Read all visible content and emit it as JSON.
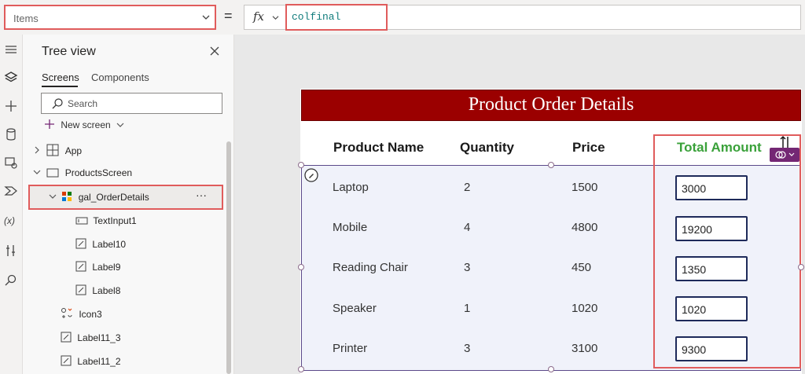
{
  "formula_bar": {
    "property": "Items",
    "equals": "=",
    "fx": "fx",
    "formula": "colfinal"
  },
  "tree_view": {
    "title": "Tree view",
    "tabs": [
      "Screens",
      "Components"
    ],
    "search_placeholder": "Search",
    "new_screen": "New screen",
    "items": [
      {
        "label": "App"
      },
      {
        "label": "ProductsScreen"
      },
      {
        "label": "gal_OrderDetails",
        "more": "···"
      },
      {
        "label": "TextInput1"
      },
      {
        "label": "Label10"
      },
      {
        "label": "Label9"
      },
      {
        "label": "Label8"
      },
      {
        "label": "Icon3"
      },
      {
        "label": "Label11_3"
      },
      {
        "label": "Label11_2"
      }
    ]
  },
  "screen": {
    "title": "Product Order Details",
    "headers": [
      "Product Name",
      "Quantity",
      "Price",
      "Total Amount"
    ],
    "rows": [
      {
        "name": "Laptop",
        "qty": "2",
        "price": "1500",
        "total": "3000"
      },
      {
        "name": "Mobile",
        "qty": "4",
        "price": "4800",
        "total": "19200"
      },
      {
        "name": "Reading Chair",
        "qty": "3",
        "price": "450",
        "total": "1350"
      },
      {
        "name": "Speaker",
        "qty": "1",
        "price": "1020",
        "total": "1020"
      },
      {
        "name": "Printer",
        "qty": "3",
        "price": "3100",
        "total": "9300"
      }
    ]
  },
  "colors": {
    "title_bar": "#9b0000",
    "total_header": "#3aa13a",
    "highlight": "#e05c5c",
    "gallery_border": "#5c4a8a"
  }
}
